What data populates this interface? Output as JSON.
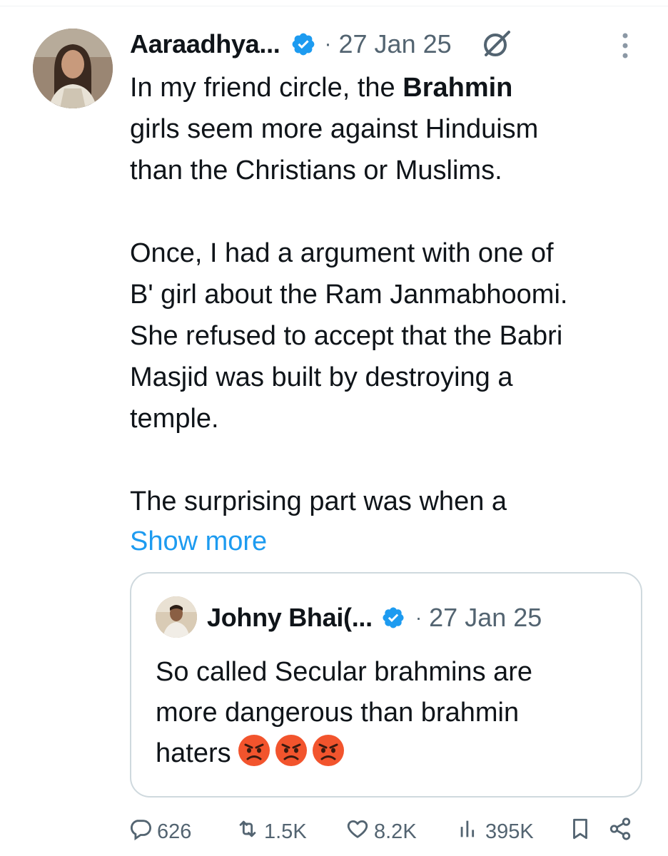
{
  "tweet": {
    "author_name": "Aaraadhya...",
    "separator": "·",
    "date": "27 Jan 25",
    "text_line_1_pre": "In my friend circle, the ",
    "text_line_1_bold": "Brahmin",
    "text_line_2": "girls seem more against Hinduism",
    "text_line_3": "than the Christians or Muslims.",
    "text_line_4": "Once, I had a argument with one of",
    "text_line_5": "B' girl about the Ram Janmabhoomi.",
    "text_line_6": "She refused to accept that the Babri",
    "text_line_7": "Masjid was built by destroying a",
    "text_line_8": "temple.",
    "text_line_9": "The surprising part was when a",
    "show_more": "Show more"
  },
  "quote": {
    "author_name": "Johny Bhai(...",
    "separator": "·",
    "date": "27 Jan 25",
    "text_line_1": "So called Secular brahmins are",
    "text_line_2": "more dangerous than brahmin",
    "text_line_3": "haters",
    "emoji_name": "angry-face-emoji",
    "emoji_count": 3
  },
  "actions": {
    "replies": "626",
    "reposts": "1.5K",
    "likes": "8.2K",
    "views": "395K"
  },
  "icons": {
    "verified": "verified-badge-icon",
    "grok": "grok-icon",
    "more": "more-vertical-icon",
    "reply": "reply-icon",
    "repost": "repost-icon",
    "like": "heart-icon",
    "views": "views-icon",
    "bookmark": "bookmark-icon",
    "share": "share-icon"
  },
  "colors": {
    "text_primary": "#0f1419",
    "text_secondary": "#536471",
    "link": "#1d9bf0",
    "verified": "#1d9bf0",
    "border": "#cfd9de"
  }
}
